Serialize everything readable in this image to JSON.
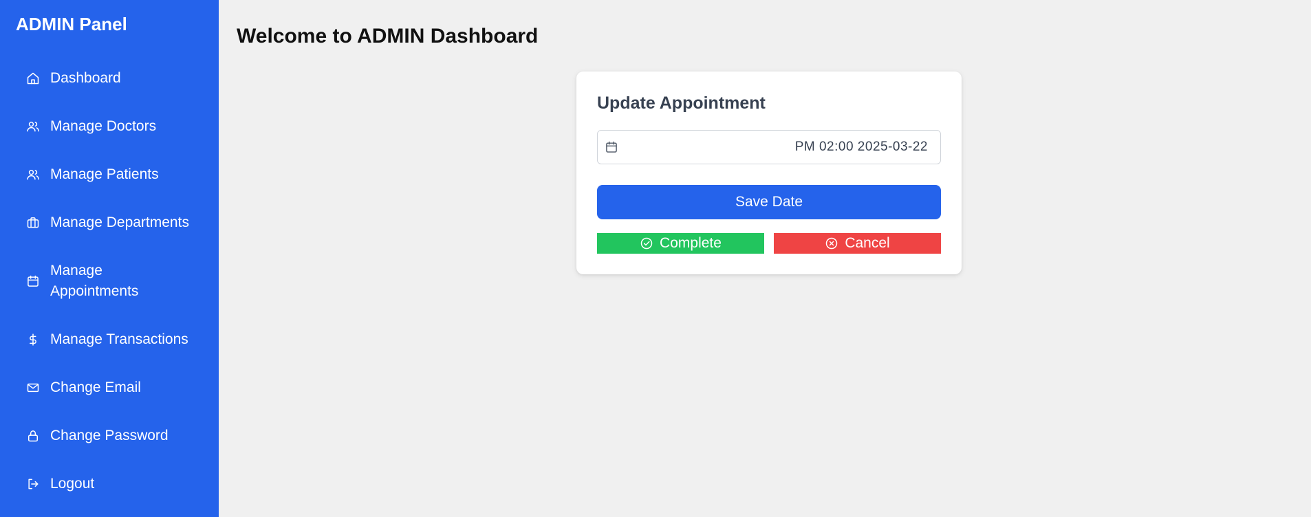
{
  "sidebar": {
    "brand": "ADMIN Panel",
    "items": [
      {
        "label": "Dashboard",
        "icon": "home-icon"
      },
      {
        "label": "Manage Doctors",
        "icon": "users-icon"
      },
      {
        "label": "Manage Patients",
        "icon": "users-icon"
      },
      {
        "label": "Manage Departments",
        "icon": "briefcase-icon"
      },
      {
        "label": "Manage Appointments",
        "icon": "calendar-icon"
      },
      {
        "label": "Manage Transactions",
        "icon": "dollar-icon"
      },
      {
        "label": "Change Email",
        "icon": "mail-icon"
      },
      {
        "label": "Change Password",
        "icon": "lock-icon"
      },
      {
        "label": "Logout",
        "icon": "logout-icon"
      }
    ]
  },
  "main": {
    "title": "Welcome to ADMIN Dashboard"
  },
  "card": {
    "title": "Update Appointment",
    "date_value": "PM 02:00 2025-03-22",
    "save_label": "Save Date",
    "complete_label": "Complete",
    "cancel_label": "Cancel"
  },
  "colors": {
    "sidebar_bg": "#2563eb",
    "primary": "#2563eb",
    "success": "#22c55e",
    "danger": "#ef4444",
    "page_bg": "#f0f0f0"
  }
}
